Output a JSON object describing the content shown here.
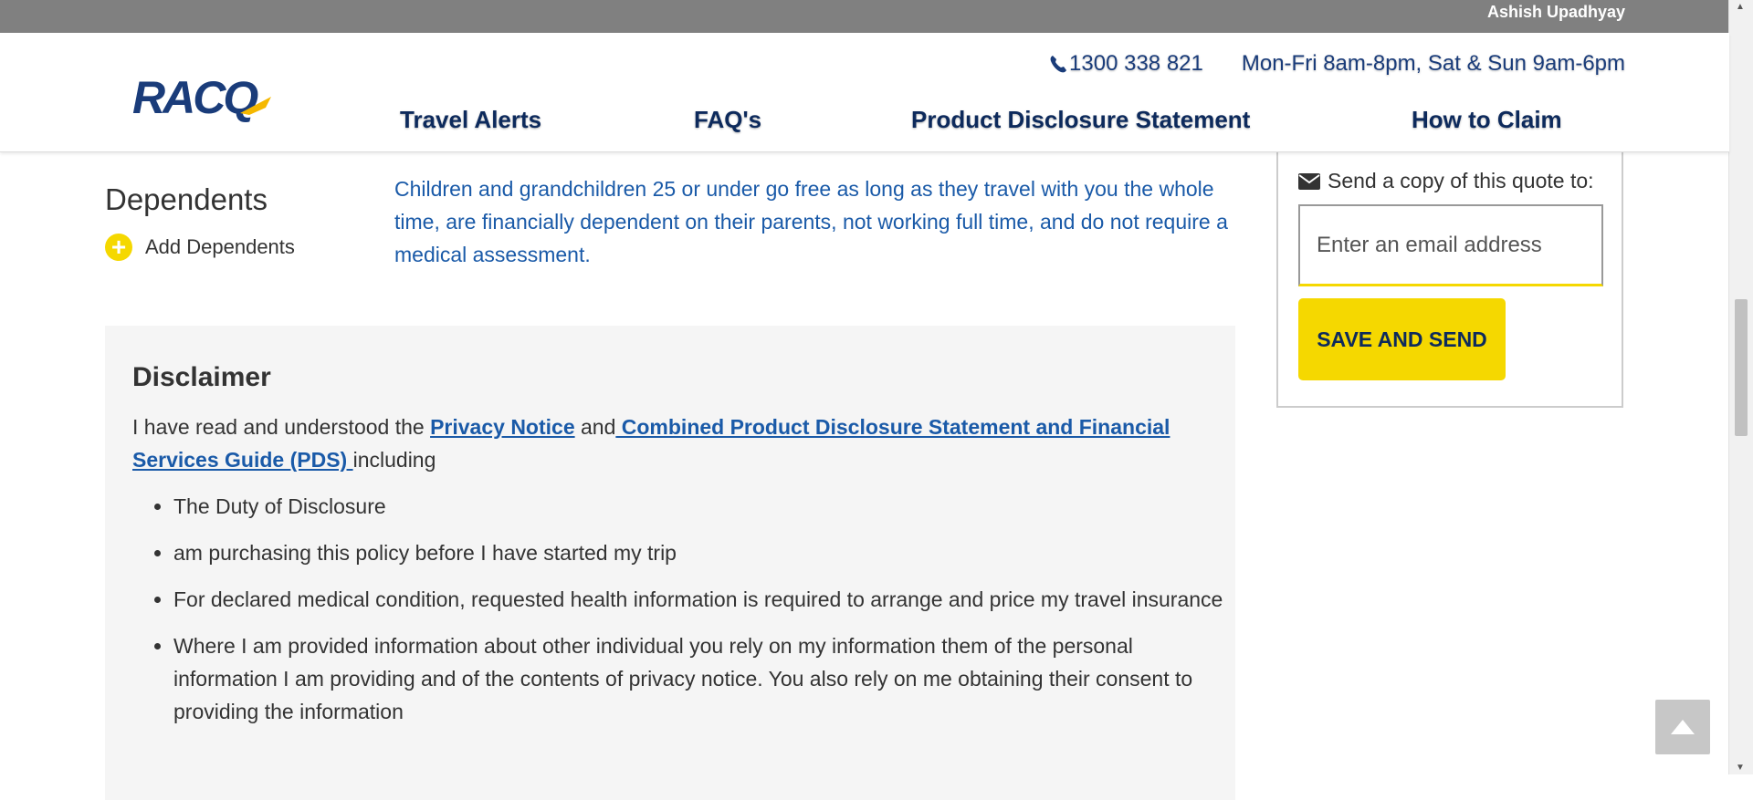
{
  "topbar": {
    "user_name": "Ashish Upadhyay"
  },
  "header": {
    "logo_text": "RACQ",
    "phone": "1300 338 821",
    "hours": "Mon-Fri 8am-8pm, Sat & Sun 9am-6pm",
    "nav": [
      "Travel Alerts",
      "FAQ's",
      "Product Disclosure Statement",
      "How to Claim"
    ]
  },
  "dependents": {
    "title": "Dependents",
    "add_label": "Add Dependents",
    "description": "Children and grandchildren 25 or under go free as long as they travel with you the whole time, are financially dependent on their parents, not working full time, and do not require a medical assessment."
  },
  "quote": {
    "label": "Send a copy of this quote to:",
    "email_placeholder": "Enter an email address",
    "email_value": "",
    "button": "SAVE AND SEND"
  },
  "disclaimer": {
    "title": "Disclaimer",
    "intro_prefix": "I have read and understood the ",
    "privacy_link": "Privacy Notice",
    "and": " and",
    "pds_link": " Combined Product Disclosure Statement and Financial Services Guide (PDS) ",
    "suffix": "including",
    "items": [
      "The Duty of Disclosure",
      "am purchasing this policy before I have started my trip",
      "For declared medical condition, requested health information is required to arrange and price my travel insurance",
      "Where I am provided information about other individual you rely on my information them of the personal information I am providing and of the contents of privacy notice. You also rely on me obtaining their consent to providing the information"
    ]
  },
  "colors": {
    "accent_yellow": "#f5d800",
    "brand_navy": "#0d2a5c",
    "link_blue": "#1a5aa8",
    "topbar_gray": "#808080"
  },
  "icons": [
    "phone-icon",
    "mail-icon",
    "plus-circle-icon",
    "chevron-up-icon"
  ]
}
